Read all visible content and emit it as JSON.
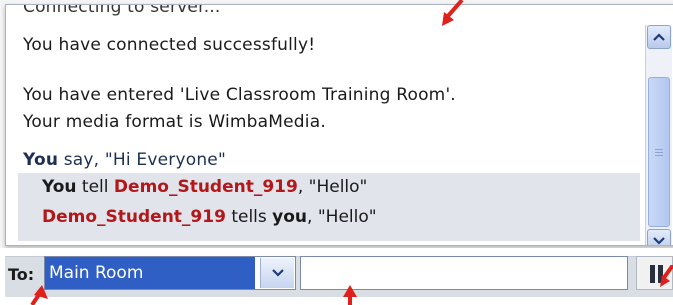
{
  "chat": {
    "cutoff_line": "Connecting to server...",
    "connected": "You have connected successfully!",
    "entered": "You have entered 'Live Classroom Training Room'.",
    "media": "Your media format is WimbaMedia.",
    "say_you": "You",
    "say_text": " say, \"Hi Everyone\"",
    "tell_you": "You",
    "tell_verb": " tell ",
    "tell_target": "Demo_Student_919",
    "tell_msg": ", \"Hello\"",
    "reply_sender": "Demo_Student_919",
    "reply_verb": " tells ",
    "reply_you": "you",
    "reply_msg": ", \"Hello\""
  },
  "composer": {
    "to_label": "To:",
    "recipient": "Main Room",
    "message_value": ""
  },
  "colors": {
    "accent_red": "#e0201a",
    "student_red": "#b3171a",
    "select_blue": "#2f5fc4"
  },
  "icons": {
    "scroll_up": "chevron-up-icon",
    "scroll_down": "chevron-down-icon",
    "dropdown": "chevron-down-icon",
    "send": "pause-icon"
  }
}
